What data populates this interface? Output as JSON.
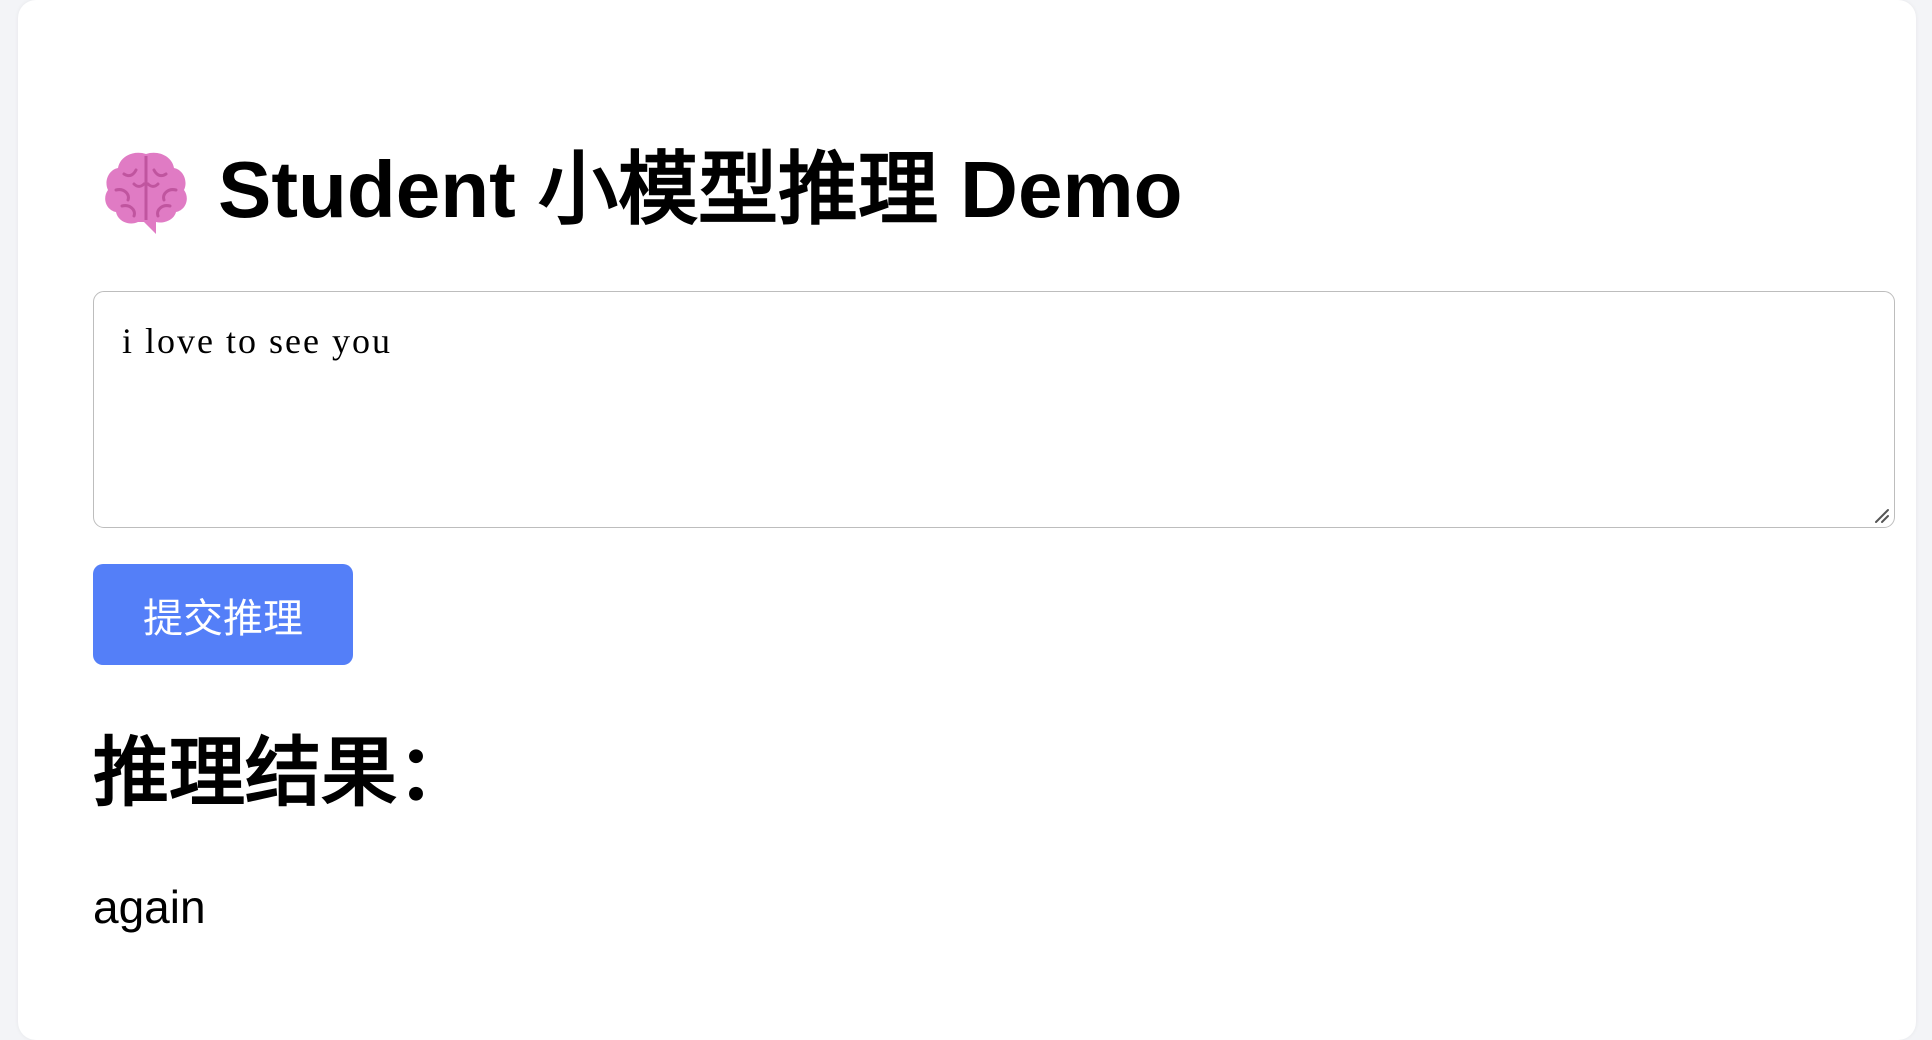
{
  "header": {
    "icon": "brain-icon",
    "title": "Student 小模型推理 Demo"
  },
  "input": {
    "value": "i love to see you"
  },
  "actions": {
    "submit_label": "提交推理"
  },
  "result": {
    "heading": "推理结果：",
    "text": "again"
  },
  "colors": {
    "accent": "#547ff8",
    "brain": "#e07bc4"
  }
}
